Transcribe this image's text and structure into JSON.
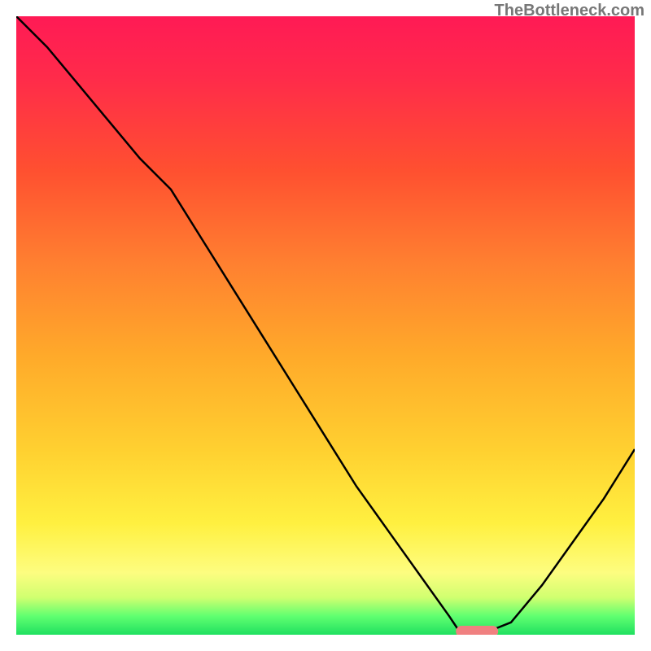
{
  "attribution": "TheBottleneck.com",
  "chart_data": {
    "type": "line",
    "title": "",
    "xlabel": "",
    "ylabel": "",
    "xlim": [
      0,
      100
    ],
    "ylim": [
      0,
      100
    ],
    "x": [
      0,
      5,
      10,
      15,
      20,
      25,
      30,
      35,
      40,
      45,
      50,
      55,
      60,
      65,
      70,
      72,
      75,
      80,
      85,
      90,
      95,
      100
    ],
    "values": [
      100,
      95,
      89,
      83,
      77,
      72,
      64,
      56,
      48,
      40,
      32,
      24,
      17,
      10,
      3,
      0,
      0,
      2,
      8,
      15,
      22,
      30
    ],
    "marker": {
      "x_start": 72,
      "x_end": 77,
      "y": 0,
      "color": "#f08080"
    },
    "gradient_stops": [
      {
        "pct": 0,
        "color": "#ff1a55"
      },
      {
        "pct": 50,
        "color": "#ffaa2a"
      },
      {
        "pct": 90,
        "color": "#fdfd80"
      },
      {
        "pct": 100,
        "color": "#20e060"
      }
    ]
  }
}
